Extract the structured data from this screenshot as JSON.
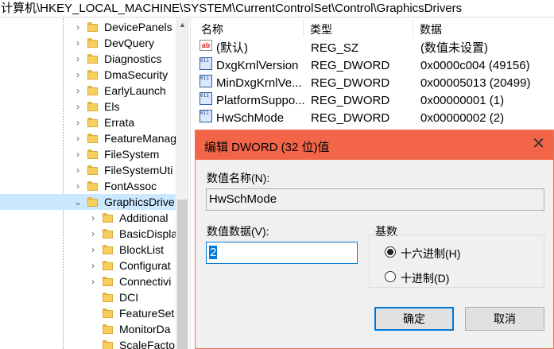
{
  "address_bar": {
    "path": "计算机\\HKEY_LOCAL_MACHINE\\SYSTEM\\CurrentControlSet\\Control\\GraphicsDrivers"
  },
  "tree": {
    "items": [
      {
        "label": "DevicePanels",
        "level": 1,
        "expand": "collapsed"
      },
      {
        "label": "DevQuery",
        "level": 1,
        "expand": "collapsed"
      },
      {
        "label": "Diagnostics",
        "level": 1,
        "expand": "collapsed"
      },
      {
        "label": "DmaSecurity",
        "level": 1,
        "expand": "collapsed"
      },
      {
        "label": "EarlyLaunch",
        "level": 1,
        "expand": "collapsed"
      },
      {
        "label": "Els",
        "level": 1,
        "expand": "collapsed"
      },
      {
        "label": "Errata",
        "level": 1,
        "expand": "collapsed"
      },
      {
        "label": "FeatureManag",
        "level": 1,
        "expand": "collapsed"
      },
      {
        "label": "FileSystem",
        "level": 1,
        "expand": "collapsed"
      },
      {
        "label": "FileSystemUti",
        "level": 1,
        "expand": "collapsed"
      },
      {
        "label": "FontAssoc",
        "level": 1,
        "expand": "collapsed"
      },
      {
        "label": "GraphicsDrive",
        "level": 1,
        "expand": "expanded",
        "selected": true
      },
      {
        "label": "Additional",
        "level": 2,
        "expand": "collapsed"
      },
      {
        "label": "BasicDispla",
        "level": 2,
        "expand": "collapsed"
      },
      {
        "label": "BlockList",
        "level": 2,
        "expand": "collapsed"
      },
      {
        "label": "Configurat",
        "level": 2,
        "expand": "collapsed"
      },
      {
        "label": "Connectivi",
        "level": 2,
        "expand": "collapsed"
      },
      {
        "label": "DCI",
        "level": 2,
        "expand": "none"
      },
      {
        "label": "FeatureSet",
        "level": 2,
        "expand": "none"
      },
      {
        "label": "MonitorDa",
        "level": 2,
        "expand": "none"
      },
      {
        "label": "ScaleFacto",
        "level": 2,
        "expand": "none"
      }
    ]
  },
  "list": {
    "columns": [
      "名称",
      "类型",
      "数据"
    ],
    "rows": [
      {
        "icon": "string-value-icon",
        "name": "(默认)",
        "type": "REG_SZ",
        "data": "(数值未设置)"
      },
      {
        "icon": "binary-value-icon",
        "name": "DxgKrnlVersion",
        "type": "REG_DWORD",
        "data": "0x0000c004 (49156)"
      },
      {
        "icon": "binary-value-icon",
        "name": "MinDxgKrnlVe...",
        "type": "REG_DWORD",
        "data": "0x00005013 (20499)"
      },
      {
        "icon": "binary-value-icon",
        "name": "PlatformSuppo...",
        "type": "REG_DWORD",
        "data": "0x00000001 (1)"
      },
      {
        "icon": "binary-value-icon",
        "name": "HwSchMode",
        "type": "REG_DWORD",
        "data": "0x00000002 (2)"
      }
    ]
  },
  "dialog": {
    "title": "编辑 DWORD (32 位)值",
    "close_symbol": "✕",
    "name_label": "数值名称(N):",
    "name_value": "HwSchMode",
    "data_label": "数值数据(V):",
    "data_value": "2",
    "base_label": "基数",
    "radio_hex": "十六进制(H)",
    "radio_dec": "十进制(D)",
    "base_selected": "hex",
    "ok_label": "确定",
    "cancel_label": "取消",
    "accent_color": "#f26548"
  }
}
